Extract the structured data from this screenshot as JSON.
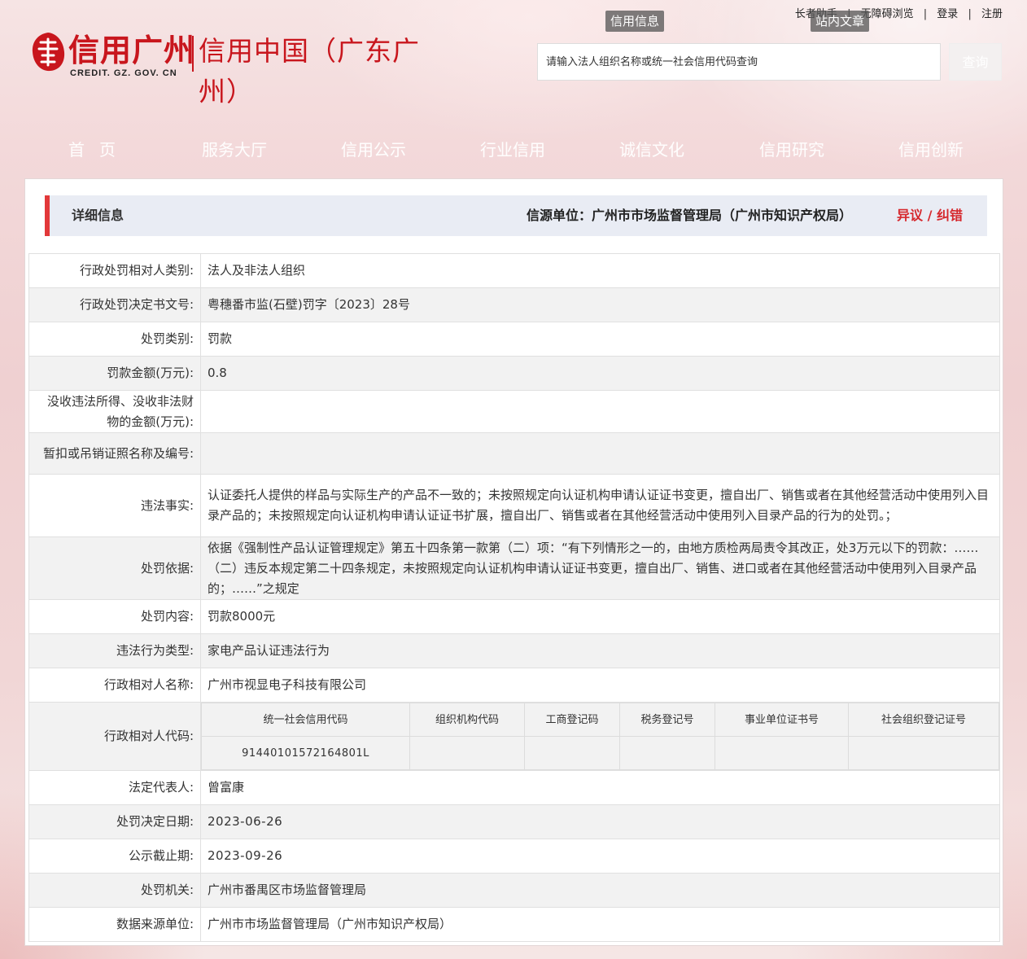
{
  "header": {
    "logo_cn": "信用广州",
    "logo_en": "CREDIT. GZ. GOV. CN",
    "logo_cn2": "信用中国（广东广州）",
    "top_links": [
      "长者助手",
      "无障碍浏览",
      "登录",
      "注册"
    ],
    "tag_credit_info": "信用信息",
    "tag_site_articles": "站内文章",
    "search_placeholder": "请输入法人组织名称或统一社会信用代码查询",
    "search_button": "查询"
  },
  "nav": [
    "首页",
    "服务大厅",
    "信用公示",
    "行业信用",
    "诚信文化",
    "信用研究",
    "信用创新"
  ],
  "detail": {
    "title": "详细信息",
    "source": "信源单位：广州市市场监督管理局（广州市知识产权局）",
    "objection": "异议 / 纠错"
  },
  "rows": {
    "r1": {
      "label": "行政处罚相对人类别:",
      "value": "法人及非法人组织"
    },
    "r2": {
      "label": "行政处罚决定书文号:",
      "value": "粤穗番市监(石壁)罚字〔2023〕28号"
    },
    "r3": {
      "label": "处罚类别:",
      "value": "罚款"
    },
    "r4": {
      "label": "罚款金额(万元):",
      "value": "0.8"
    },
    "r5": {
      "label": "没收违法所得、没收非法财物的金额(万元):",
      "value": ""
    },
    "r6": {
      "label": "暂扣或吊销证照名称及编号:",
      "value": ""
    },
    "r7": {
      "label": "违法事实:",
      "value": "认证委托人提供的样品与实际生产的产品不一致的；未按照规定向认证机构申请认证证书变更，擅自出厂、销售或者在其他经营活动中使用列入目录产品的；未按照规定向认证机构申请认证证书扩展，擅自出厂、销售或者在其他经营活动中使用列入目录产品的行为的处罚。；"
    },
    "r8": {
      "label": "处罚依据:",
      "value": "依据《强制性产品认证管理规定》第五十四条第一款第（二）项：“有下列情形之一的，由地方质检两局责令其改正，处3万元以下的罚款：……（二）违反本规定第二十四条规定，未按照规定向认证机构申请认证证书变更，擅自出厂、销售、进口或者在其他经营活动中使用列入目录产品的；……”之规定"
    },
    "r9": {
      "label": "处罚内容:",
      "value": "罚款8000元"
    },
    "r10": {
      "label": "违法行为类型:",
      "value": "家电产品认证违法行为"
    },
    "r11": {
      "label": "行政相对人名称:",
      "value": "广州市视显电子科技有限公司"
    },
    "r12": {
      "label": "行政相对人代码:",
      "headers": [
        "统一社会信用代码",
        "组织机构代码",
        "工商登记码",
        "税务登记号",
        "事业单位证书号",
        "社会组织登记证号"
      ],
      "values": [
        "91440101572164801L",
        "",
        "",
        "",
        "",
        ""
      ]
    },
    "r13": {
      "label": "法定代表人:",
      "value": "曾富康"
    },
    "r14": {
      "label": "处罚决定日期:",
      "value": "2023-06-26"
    },
    "r15": {
      "label": "公示截止期:",
      "value": "2023-09-26"
    },
    "r16": {
      "label": "处罚机关:",
      "value": "广州市番禺区市场监督管理局"
    },
    "r17": {
      "label": "数据来源单位:",
      "value": "广州市市场监督管理局（广州市知识产权局）"
    }
  },
  "colors": {
    "brand_red": "#c8161d",
    "accent_red": "#e2383a",
    "objection_red": "#d6282d"
  }
}
